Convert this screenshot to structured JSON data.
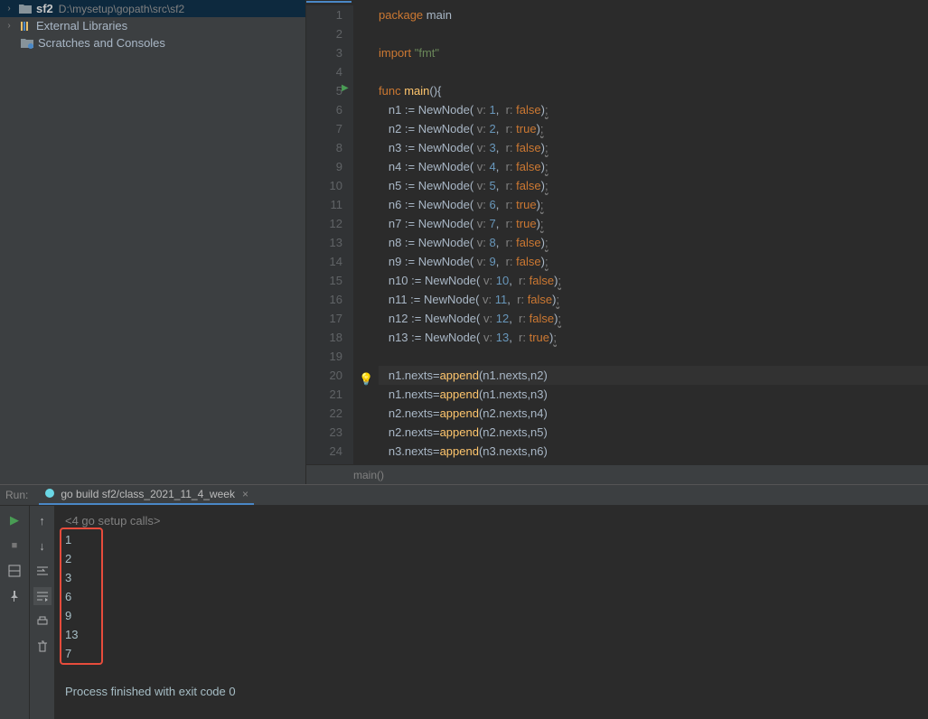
{
  "sidebar": {
    "project_name": "sf2",
    "project_path": "D:\\mysetup\\gopath\\src\\sf2",
    "external_libs": "External Libraries",
    "scratches": "Scratches and Consoles"
  },
  "code": {
    "lines": [
      {
        "n": 1,
        "parts": [
          {
            "t": "package ",
            "c": "kw"
          },
          {
            "t": "main",
            "c": ""
          }
        ]
      },
      {
        "n": 2,
        "parts": []
      },
      {
        "n": 3,
        "parts": [
          {
            "t": "import ",
            "c": "kw"
          },
          {
            "t": "\"fmt\"",
            "c": "str"
          }
        ]
      },
      {
        "n": 4,
        "parts": []
      },
      {
        "n": 5,
        "parts": [
          {
            "t": "func ",
            "c": "kw"
          },
          {
            "t": "main",
            "c": "fn"
          },
          {
            "t": "(){",
            "c": ""
          }
        ]
      },
      {
        "n": 6,
        "parts": [
          {
            "t": "   n1 := ",
            "c": ""
          },
          {
            "t": "NewNode",
            "c": ""
          },
          {
            "t": "( ",
            "c": ""
          },
          {
            "t": "v: ",
            "c": "param"
          },
          {
            "t": "1",
            "c": "num"
          },
          {
            "t": ",  ",
            "c": ""
          },
          {
            "t": "r: ",
            "c": "param"
          },
          {
            "t": "false",
            "c": "bool"
          },
          {
            "t": ")",
            "c": ""
          },
          {
            "t": ";",
            "c": "semicolon-hint"
          }
        ]
      },
      {
        "n": 7,
        "parts": [
          {
            "t": "   n2 := ",
            "c": ""
          },
          {
            "t": "NewNode",
            "c": ""
          },
          {
            "t": "( ",
            "c": ""
          },
          {
            "t": "v: ",
            "c": "param"
          },
          {
            "t": "2",
            "c": "num"
          },
          {
            "t": ",  ",
            "c": ""
          },
          {
            "t": "r: ",
            "c": "param"
          },
          {
            "t": "true",
            "c": "bool"
          },
          {
            "t": ")",
            "c": ""
          },
          {
            "t": ";",
            "c": "semicolon-hint"
          }
        ]
      },
      {
        "n": 8,
        "parts": [
          {
            "t": "   n3 := ",
            "c": ""
          },
          {
            "t": "NewNode",
            "c": ""
          },
          {
            "t": "( ",
            "c": ""
          },
          {
            "t": "v: ",
            "c": "param"
          },
          {
            "t": "3",
            "c": "num"
          },
          {
            "t": ",  ",
            "c": ""
          },
          {
            "t": "r: ",
            "c": "param"
          },
          {
            "t": "false",
            "c": "bool"
          },
          {
            "t": ")",
            "c": ""
          },
          {
            "t": ";",
            "c": "semicolon-hint"
          }
        ]
      },
      {
        "n": 9,
        "parts": [
          {
            "t": "   n4 := ",
            "c": ""
          },
          {
            "t": "NewNode",
            "c": ""
          },
          {
            "t": "( ",
            "c": ""
          },
          {
            "t": "v: ",
            "c": "param"
          },
          {
            "t": "4",
            "c": "num"
          },
          {
            "t": ",  ",
            "c": ""
          },
          {
            "t": "r: ",
            "c": "param"
          },
          {
            "t": "false",
            "c": "bool"
          },
          {
            "t": ")",
            "c": ""
          },
          {
            "t": ";",
            "c": "semicolon-hint"
          }
        ]
      },
      {
        "n": 10,
        "parts": [
          {
            "t": "   n5 := ",
            "c": ""
          },
          {
            "t": "NewNode",
            "c": ""
          },
          {
            "t": "( ",
            "c": ""
          },
          {
            "t": "v: ",
            "c": "param"
          },
          {
            "t": "5",
            "c": "num"
          },
          {
            "t": ",  ",
            "c": ""
          },
          {
            "t": "r: ",
            "c": "param"
          },
          {
            "t": "false",
            "c": "bool"
          },
          {
            "t": ")",
            "c": ""
          },
          {
            "t": ";",
            "c": "semicolon-hint"
          }
        ]
      },
      {
        "n": 11,
        "parts": [
          {
            "t": "   n6 := ",
            "c": ""
          },
          {
            "t": "NewNode",
            "c": ""
          },
          {
            "t": "( ",
            "c": ""
          },
          {
            "t": "v: ",
            "c": "param"
          },
          {
            "t": "6",
            "c": "num"
          },
          {
            "t": ",  ",
            "c": ""
          },
          {
            "t": "r: ",
            "c": "param"
          },
          {
            "t": "true",
            "c": "bool"
          },
          {
            "t": ")",
            "c": ""
          },
          {
            "t": ";",
            "c": "semicolon-hint"
          }
        ]
      },
      {
        "n": 12,
        "parts": [
          {
            "t": "   n7 := ",
            "c": ""
          },
          {
            "t": "NewNode",
            "c": ""
          },
          {
            "t": "( ",
            "c": ""
          },
          {
            "t": "v: ",
            "c": "param"
          },
          {
            "t": "7",
            "c": "num"
          },
          {
            "t": ",  ",
            "c": ""
          },
          {
            "t": "r: ",
            "c": "param"
          },
          {
            "t": "true",
            "c": "bool"
          },
          {
            "t": ")",
            "c": ""
          },
          {
            "t": ";",
            "c": "semicolon-hint"
          }
        ]
      },
      {
        "n": 13,
        "parts": [
          {
            "t": "   n8 := ",
            "c": ""
          },
          {
            "t": "NewNode",
            "c": ""
          },
          {
            "t": "( ",
            "c": ""
          },
          {
            "t": "v: ",
            "c": "param"
          },
          {
            "t": "8",
            "c": "num"
          },
          {
            "t": ",  ",
            "c": ""
          },
          {
            "t": "r: ",
            "c": "param"
          },
          {
            "t": "false",
            "c": "bool"
          },
          {
            "t": ")",
            "c": ""
          },
          {
            "t": ";",
            "c": "semicolon-hint"
          }
        ]
      },
      {
        "n": 14,
        "parts": [
          {
            "t": "   n9 := ",
            "c": ""
          },
          {
            "t": "NewNode",
            "c": ""
          },
          {
            "t": "( ",
            "c": ""
          },
          {
            "t": "v: ",
            "c": "param"
          },
          {
            "t": "9",
            "c": "num"
          },
          {
            "t": ",  ",
            "c": ""
          },
          {
            "t": "r: ",
            "c": "param"
          },
          {
            "t": "false",
            "c": "bool"
          },
          {
            "t": ")",
            "c": ""
          },
          {
            "t": ";",
            "c": "semicolon-hint"
          }
        ]
      },
      {
        "n": 15,
        "parts": [
          {
            "t": "   n10 := ",
            "c": ""
          },
          {
            "t": "NewNode",
            "c": ""
          },
          {
            "t": "( ",
            "c": ""
          },
          {
            "t": "v: ",
            "c": "param"
          },
          {
            "t": "10",
            "c": "num"
          },
          {
            "t": ",  ",
            "c": ""
          },
          {
            "t": "r: ",
            "c": "param"
          },
          {
            "t": "false",
            "c": "bool"
          },
          {
            "t": ")",
            "c": ""
          },
          {
            "t": ";",
            "c": "semicolon-hint"
          }
        ]
      },
      {
        "n": 16,
        "parts": [
          {
            "t": "   n11 := ",
            "c": ""
          },
          {
            "t": "NewNode",
            "c": ""
          },
          {
            "t": "( ",
            "c": ""
          },
          {
            "t": "v: ",
            "c": "param"
          },
          {
            "t": "11",
            "c": "num"
          },
          {
            "t": ",  ",
            "c": ""
          },
          {
            "t": "r: ",
            "c": "param"
          },
          {
            "t": "false",
            "c": "bool"
          },
          {
            "t": ")",
            "c": ""
          },
          {
            "t": ";",
            "c": "semicolon-hint"
          }
        ]
      },
      {
        "n": 17,
        "parts": [
          {
            "t": "   n12 := ",
            "c": ""
          },
          {
            "t": "NewNode",
            "c": ""
          },
          {
            "t": "( ",
            "c": ""
          },
          {
            "t": "v: ",
            "c": "param"
          },
          {
            "t": "12",
            "c": "num"
          },
          {
            "t": ",  ",
            "c": ""
          },
          {
            "t": "r: ",
            "c": "param"
          },
          {
            "t": "false",
            "c": "bool"
          },
          {
            "t": ")",
            "c": ""
          },
          {
            "t": ";",
            "c": "semicolon-hint"
          }
        ]
      },
      {
        "n": 18,
        "parts": [
          {
            "t": "   n13 := ",
            "c": ""
          },
          {
            "t": "NewNode",
            "c": ""
          },
          {
            "t": "( ",
            "c": ""
          },
          {
            "t": "v: ",
            "c": "param"
          },
          {
            "t": "13",
            "c": "num"
          },
          {
            "t": ",  ",
            "c": ""
          },
          {
            "t": "r: ",
            "c": "param"
          },
          {
            "t": "true",
            "c": "bool"
          },
          {
            "t": ")",
            "c": ""
          },
          {
            "t": ";",
            "c": "semicolon-hint"
          }
        ]
      },
      {
        "n": 19,
        "parts": []
      },
      {
        "n": 20,
        "hl": true,
        "parts": [
          {
            "t": "   n1.nexts=",
            "c": ""
          },
          {
            "t": "append",
            "c": "fn"
          },
          {
            "t": "(n1.nexts,n2)",
            "c": ""
          }
        ]
      },
      {
        "n": 21,
        "parts": [
          {
            "t": "   n1.nexts=",
            "c": ""
          },
          {
            "t": "append",
            "c": "fn"
          },
          {
            "t": "(n1.nexts,n3)",
            "c": ""
          }
        ]
      },
      {
        "n": 22,
        "parts": [
          {
            "t": "   n2.nexts=",
            "c": ""
          },
          {
            "t": "append",
            "c": "fn"
          },
          {
            "t": "(n2.nexts,n4)",
            "c": ""
          }
        ]
      },
      {
        "n": 23,
        "parts": [
          {
            "t": "   n2.nexts=",
            "c": ""
          },
          {
            "t": "append",
            "c": "fn"
          },
          {
            "t": "(n2.nexts,n5)",
            "c": ""
          }
        ]
      },
      {
        "n": 24,
        "parts": [
          {
            "t": "   n3.nexts=",
            "c": ""
          },
          {
            "t": "append",
            "c": "fn"
          },
          {
            "t": "(n3.nexts,n6)",
            "c": ""
          }
        ]
      }
    ]
  },
  "breadcrumb": "main()",
  "run": {
    "label": "Run:",
    "tab": "go build sf2/class_2021_11_4_week",
    "setup": "<4 go setup calls>",
    "output": [
      "1",
      "2",
      "3",
      "6",
      "9",
      "13",
      "7"
    ],
    "exit": "Process finished with exit code 0"
  }
}
